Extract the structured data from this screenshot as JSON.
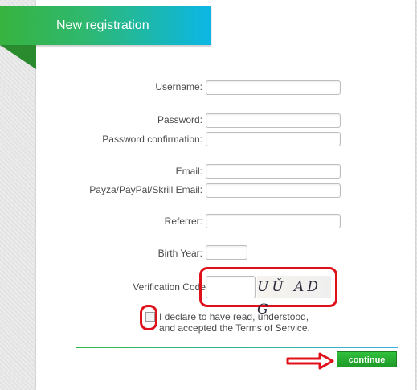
{
  "header": {
    "title": "New registration"
  },
  "form": {
    "username_label": "Username:",
    "password_label": "Password:",
    "password_confirmation_label": "Password confirmation:",
    "email_label": "Email:",
    "payment_email_label": "Payza/PayPal/Skrill Email:",
    "referrer_label": "Referrer:",
    "birth_year_label": "Birth Year:",
    "verification_code_label": "Verification Code",
    "captcha_text": "UǓ AD G",
    "terms_line1": "I declare to have read, understood,",
    "terms_line2": "and accepted the Terms of Service.",
    "continue_label": "continue"
  },
  "colors": {
    "accent_green": "#2db84a",
    "accent_blue": "#0bb7e6",
    "highlight_red": "#e0101a"
  }
}
